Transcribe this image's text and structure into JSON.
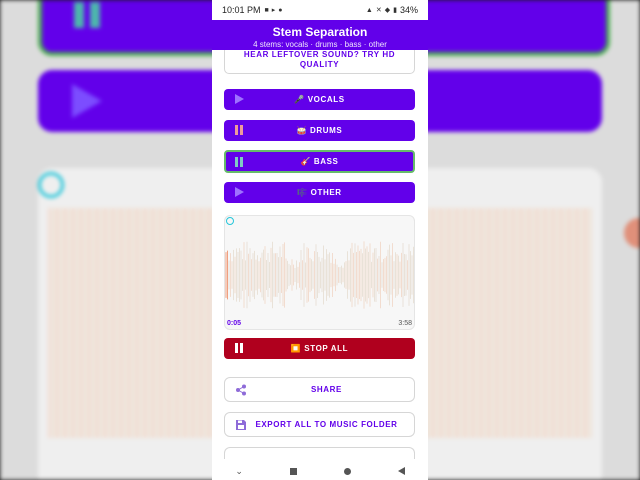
{
  "status_bar": {
    "time": "10:01 PM",
    "battery": "34%"
  },
  "app_bar": {
    "title": "Stem Separation",
    "subtitle": "4 stems: vocals · drums · bass · other"
  },
  "hd_banner": {
    "label": "HEAR LEFTOVER SOUND? TRY HD QUALITY"
  },
  "stems": [
    {
      "label": "🎤 VOCALS",
      "state": "play",
      "icon": "play-icon"
    },
    {
      "label": "🥁 DRUMS",
      "state": "pause",
      "icon": "pause-icon"
    },
    {
      "label": "🎸 BASS",
      "state": "pause",
      "icon": "pause-icon",
      "selected": true
    },
    {
      "label": "🎼 OTHER",
      "state": "play",
      "icon": "play-icon"
    }
  ],
  "player": {
    "current_time": "0:05",
    "total_time": "3:58",
    "progress": 0.02
  },
  "stop_all": {
    "label": "⏹️ STOP ALL"
  },
  "actions": {
    "share_label": "SHARE",
    "export_label": "EXPORT ALL TO MUSIC FOLDER"
  },
  "colors": {
    "primary": "#6200ea",
    "stop": "#b0001e",
    "selected_border": "#66bb6a",
    "accent": "#26c6da"
  }
}
